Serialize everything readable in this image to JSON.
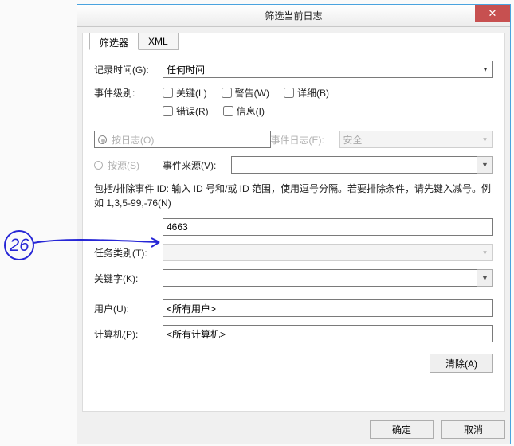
{
  "title": "筛选当前日志",
  "tabs": {
    "filter": "筛选器",
    "xml": "XML"
  },
  "labels": {
    "logged": "记录时间(G):",
    "level": "事件级别:",
    "bylog": "按日志(O)",
    "bysource": "按源(S)",
    "eventlog": "事件日志(E):",
    "source": "事件来源(V):",
    "help": "包括/排除事件 ID: 输入 ID 号和/或 ID 范围，使用逗号分隔。若要排除条件，请先键入减号。例如 1,3,5-99,-76(N)",
    "task": "任务类别(T):",
    "keywords": "关键字(K):",
    "user": "用户(U):",
    "computer": "计算机(P):"
  },
  "values": {
    "logged": "任何时间",
    "eventlog": "安全",
    "source": "",
    "id": "4663",
    "task": "",
    "keywords": "",
    "user": "<所有用户>",
    "computer": "<所有计算机>"
  },
  "chk": {
    "critical": "关键(L)",
    "warn": "警告(W)",
    "verbose": "详细(B)",
    "error": "错误(R)",
    "info": "信息(I)"
  },
  "buttons": {
    "clear": "清除(A)",
    "ok": "确定",
    "cancel": "取消"
  },
  "annotation": "26"
}
